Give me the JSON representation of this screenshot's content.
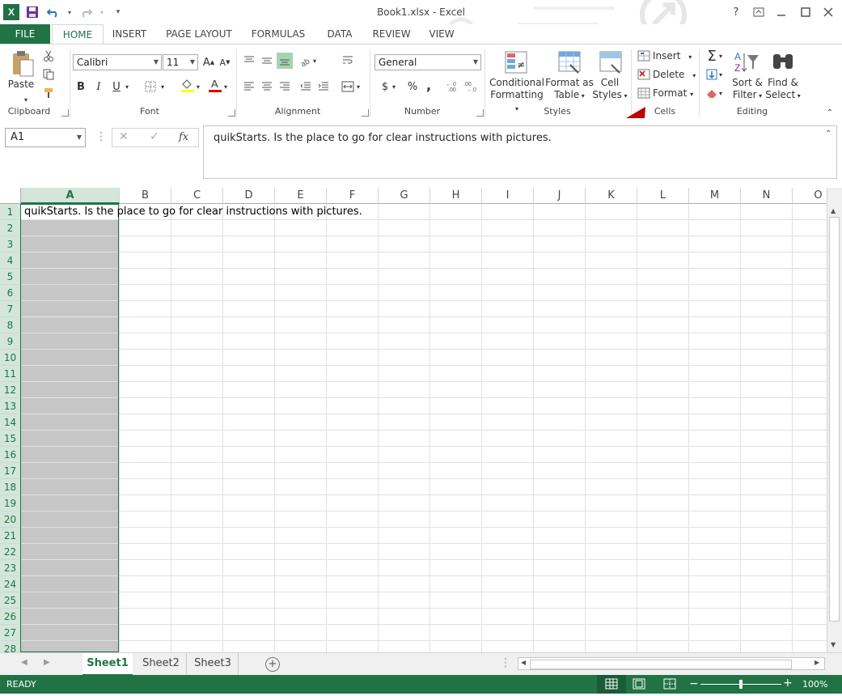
{
  "window": {
    "title": "Book1.xlsx - Excel",
    "help": "?",
    "controls": [
      "ribbon-display",
      "minimize",
      "maximize",
      "close"
    ]
  },
  "tabs": [
    "FILE",
    "HOME",
    "INSERT",
    "PAGE LAYOUT",
    "FORMULAS",
    "DATA",
    "REVIEW",
    "VIEW"
  ],
  "ribbon": {
    "clipboard": {
      "paste": "Paste",
      "label": "Clipboard"
    },
    "font": {
      "name": "Calibri",
      "size": "11",
      "label": "Font",
      "bold": "B",
      "italic": "I",
      "underline": "U"
    },
    "alignment": {
      "label": "Alignment"
    },
    "number": {
      "format": "General",
      "label": "Number",
      "currency": "$",
      "percent": "%",
      "comma": ","
    },
    "styles": {
      "conditional_1": "Conditional",
      "conditional_2": "Formatting",
      "table_1": "Format as",
      "table_2": "Table",
      "cell_1": "Cell",
      "cell_2": "Styles",
      "label": "Styles"
    },
    "cells": {
      "insert": "Insert",
      "delete": "Delete",
      "format": "Format",
      "label": "Cells"
    },
    "editing": {
      "sort_1": "Sort &",
      "sort_2": "Filter",
      "find_1": "Find &",
      "find_2": "Select",
      "label": "Editing"
    }
  },
  "formula_bar": {
    "name_box": "A1",
    "value": "quikStarts. Is the place to go for clear instructions with pictures."
  },
  "grid": {
    "columns": [
      "A",
      "B",
      "C",
      "D",
      "E",
      "F",
      "G",
      "H",
      "I",
      "J",
      "K",
      "L",
      "M",
      "N",
      "O"
    ],
    "rows": [
      "1",
      "2",
      "3",
      "4",
      "5",
      "6",
      "7",
      "8",
      "9",
      "10",
      "11",
      "12",
      "13",
      "14",
      "15",
      "16",
      "17",
      "18",
      "19",
      "20",
      "21",
      "22",
      "23",
      "24",
      "25",
      "26",
      "27",
      "28"
    ],
    "a1": "quikStarts. Is the place to go for clear instructions with pictures."
  },
  "sheets": [
    "Sheet1",
    "Sheet2",
    "Sheet3"
  ],
  "status": {
    "ready": "READY",
    "zoom": "100%"
  },
  "colors": {
    "accent": "#217346",
    "selection": "#c6c6c6",
    "arrow": "#c00000"
  }
}
